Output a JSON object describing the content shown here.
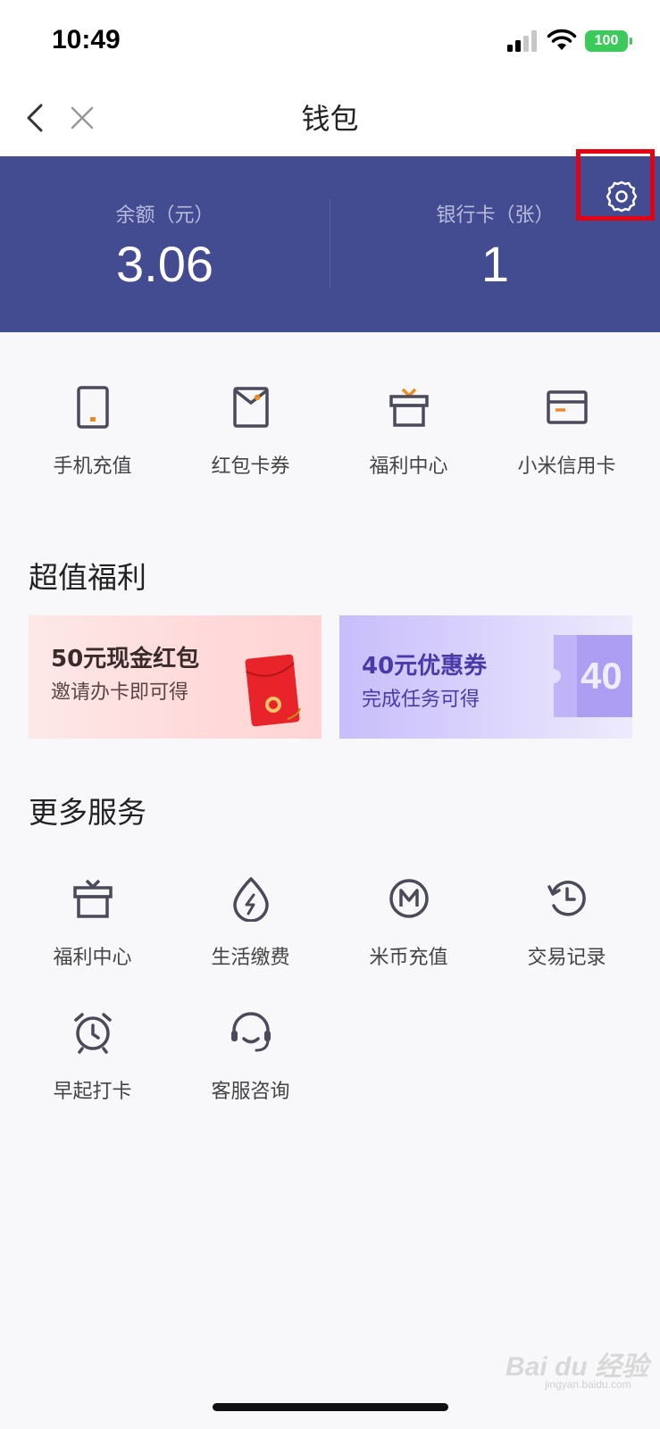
{
  "status_bar": {
    "time": "10:49",
    "battery": "100"
  },
  "nav": {
    "title": "钱包"
  },
  "balance": {
    "label": "余额（元）",
    "value": "3.06"
  },
  "bank_cards": {
    "label": "银行卡（张）",
    "value": "1"
  },
  "quick_actions": [
    {
      "label": "手机充值",
      "icon": "phone-icon"
    },
    {
      "label": "红包卡券",
      "icon": "envelope-icon"
    },
    {
      "label": "福利中心",
      "icon": "gift-icon"
    },
    {
      "label": "小米信用卡",
      "icon": "credit-card-icon"
    }
  ],
  "benefits": {
    "title": "超值福利",
    "cards": [
      {
        "title": "50元现金红包",
        "subtitle": "邀请办卡即可得"
      },
      {
        "title": "40元优惠券",
        "subtitle": "完成任务可得",
        "badge": "40"
      }
    ]
  },
  "more_services": {
    "title": "更多服务",
    "items": [
      {
        "label": "福利中心",
        "icon": "gift-icon"
      },
      {
        "label": "生活缴费",
        "icon": "bolt-drop-icon"
      },
      {
        "label": "米币充值",
        "icon": "mi-coin-icon"
      },
      {
        "label": "交易记录",
        "icon": "history-clock-icon"
      },
      {
        "label": "早起打卡",
        "icon": "alarm-clock-icon"
      },
      {
        "label": "客服咨询",
        "icon": "headset-icon"
      }
    ]
  },
  "watermark": {
    "text": "Bai du 经验",
    "sub": "jingyan.baidu.com"
  },
  "colors": {
    "banner": "#434b91",
    "accent": "#f08a24",
    "icon": "#4a4a5a",
    "highlight": "#e50012"
  }
}
